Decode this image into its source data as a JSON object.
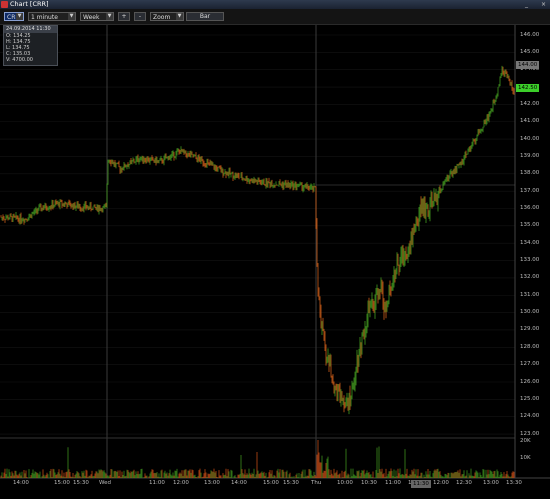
{
  "window": {
    "title": "Chart [CRR]",
    "minimize": "_",
    "close": "×"
  },
  "toolbar": {
    "symbol": "CRR",
    "interval": "1 minute",
    "range": "Week",
    "zoom_in": "+",
    "zoom_out": "-",
    "zoom": "Zoom",
    "bar": "Bar"
  },
  "info": {
    "header": "24.09.2014 11:30",
    "open": "O: 134.25",
    "high": "H: 134.75",
    "low": "L: 134.75",
    "close": "C: 135.03",
    "volume": "V: 4700.00"
  },
  "price_axis": [
    "146.00",
    "145.00",
    "144.00",
    "143.00",
    "142.00",
    "141.00",
    "140.00",
    "139.00",
    "138.00",
    "137.00",
    "136.00",
    "135.00",
    "134.00",
    "133.00",
    "132.00",
    "131.00",
    "130.00",
    "129.00",
    "128.00",
    "127.00",
    "126.00",
    "125.00",
    "124.00",
    "123.00"
  ],
  "volume_axis": [
    "20K",
    "10K"
  ],
  "time_axis": [
    "14:00",
    "15:00",
    "15:30",
    "Wed",
    "11:00",
    "12:00",
    "13:00",
    "14:00",
    "15:00",
    "15:30",
    "Thu",
    "10:00",
    "10:30",
    "11:00",
    "11:30",
    "12:00",
    "12:30",
    "13:00",
    "13:30"
  ],
  "current_price_tag": "142.50",
  "high_tag": "144.00",
  "crosshair_time_tag": "11:30",
  "colors": {
    "up": "#4caf24",
    "down": "#e86a1c",
    "grid": "#1f1f1f",
    "tag_bg": "#3ccf2a"
  },
  "chart_data": {
    "type": "candlestick",
    "x": [
      "Tue 14:00",
      "Tue 15:30",
      "Wed 10:00",
      "Wed 11:00",
      "Wed 12:00",
      "Wed 13:00",
      "Wed 14:00",
      "Wed 15:00",
      "Wed 15:30",
      "Thu 09:30",
      "Thu 10:00",
      "Thu 10:15",
      "Thu 10:30",
      "Thu 11:00",
      "Thu 11:30",
      "Thu 12:00",
      "Thu 12:30",
      "Thu 13:00",
      "Thu 13:30"
    ],
    "close": [
      135.4,
      136.0,
      138.8,
      138.8,
      139.0,
      138.2,
      137.6,
      137.3,
      137.2,
      130.5,
      124.9,
      125.3,
      130.0,
      132.4,
      136.0,
      138.5,
      141.0,
      144.0,
      142.5
    ],
    "ylim": [
      123,
      146
    ],
    "volume_ylim": [
      0,
      20000
    ]
  }
}
